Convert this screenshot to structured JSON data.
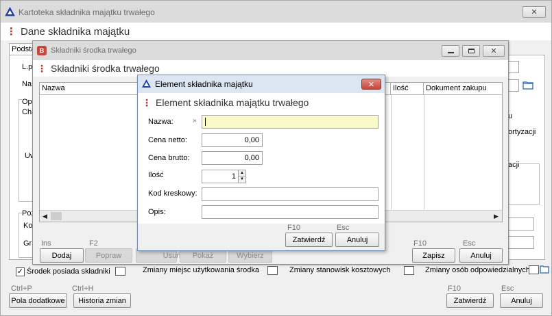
{
  "main": {
    "title": "Kartoteka składnika majątku trwałego",
    "header": "Dane składnika majątku",
    "tab": "Podstawowe",
    "bg_labels": {
      "lp": "L.p.",
      "na": "Na",
      "opi": "Opi",
      "cha": "Cha",
      "uw": "Uw",
      "poz": "Poz",
      "ko": "Ko",
      "gr": "Gr",
      "right_u": "u",
      "right_amort": "ortyzacji",
      "right_acji": "acji"
    },
    "checkboxes": {
      "srodek": {
        "label": "Środek posiada składniki",
        "checked": true
      },
      "miejsc": {
        "label": "Zmiany miejsc użytkowania środka",
        "checked": false
      },
      "stanowisk": {
        "label": "Zmiany stanowisk kosztowych",
        "checked": false
      },
      "osob": {
        "label": "Zmiany osób odpowiedzialnych",
        "checked": false
      }
    },
    "footer": {
      "pola_key": "Ctrl+P",
      "pola_label": "Pola dodatkowe",
      "historia_key": "Ctrl+H",
      "historia_label": "Historia zmian",
      "zatwierdz_key": "F10",
      "zatwierdz_label": "Zatwierdź",
      "anuluj_key": "Esc",
      "anuluj_label": "Anuluj"
    }
  },
  "components_window": {
    "title": "Składniki środka trwałego",
    "badge": "B",
    "header": "Składniki środka trwałego",
    "columns": [
      "Nazwa",
      "Ilość",
      "Dokument zakupu"
    ],
    "buttons": {
      "dodaj_key": "Ins",
      "dodaj": "Dodaj",
      "popraw_key": "F2",
      "popraw": "Popraw",
      "usun": "Usuń",
      "pokaz": "Pokaż",
      "wybierz": "Wybierz",
      "zapisz_key": "F10",
      "zapisz": "Zapisz",
      "anuluj_key": "Esc",
      "anuluj": "Anuluj"
    }
  },
  "element_dialog": {
    "title": "Element składnika majątku",
    "header": "Element składnika majątku trwałego",
    "fields": {
      "nazwa_label": "Nazwa:",
      "nazwa_value": "",
      "cena_netto_label": "Cena netto:",
      "cena_netto_value": "0,00",
      "cena_brutto_label": "Cena brutto:",
      "cena_brutto_value": "0,00",
      "ilosc_label": "Ilość",
      "ilosc_value": "1",
      "kod_label": "Kod kreskowy:",
      "kod_value": "",
      "opis_label": "Opis:",
      "opis_value": ""
    },
    "buttons": {
      "zatwierdz_key": "F10",
      "zatwierdz": "Zatwierdź",
      "anuluj_key": "Esc",
      "anuluj": "Anuluj"
    }
  },
  "colors": {
    "accent_red": "#c0392b",
    "close_red": "#c8463a",
    "required_field": "#fafac8",
    "title_active_blue": "#dce6f2"
  }
}
